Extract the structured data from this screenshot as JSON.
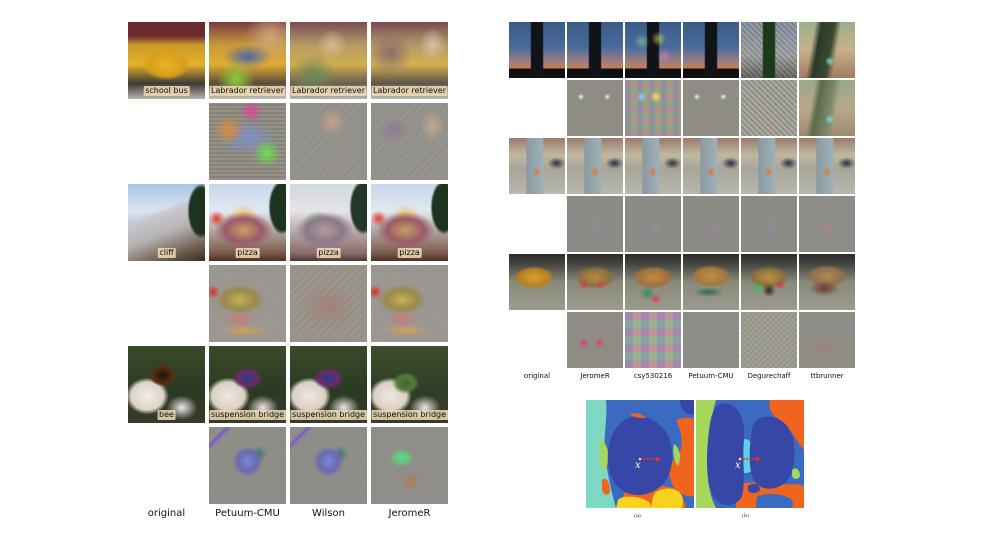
{
  "left_figure": {
    "column_labels": [
      "original",
      "Petuum-CMU",
      "Wilson",
      "JeromeR"
    ],
    "rows": [
      {
        "kind": "image",
        "labels": [
          "school bus",
          "Labrador retriever",
          "Labrador retriever",
          "Labrador retriever"
        ]
      },
      {
        "kind": "perturbation",
        "labels": [
          "",
          "",
          "",
          ""
        ]
      },
      {
        "kind": "image",
        "labels": [
          "cliff",
          "pizza",
          "pizza",
          "pizza"
        ]
      },
      {
        "kind": "perturbation",
        "labels": [
          "",
          "",
          "",
          ""
        ]
      },
      {
        "kind": "image",
        "labels": [
          "bee",
          "suspension bridge",
          "suspension bridge",
          "suspension bridge"
        ]
      },
      {
        "kind": "perturbation",
        "labels": [
          "",
          "",
          "",
          ""
        ]
      }
    ]
  },
  "right_figure": {
    "column_labels": [
      "original",
      "JeromeR",
      "csy530216",
      "Petuum-CMU",
      "Degurechaff",
      "ttbrunner"
    ],
    "rows": [
      {
        "kind": "image",
        "subject": "lighthouse"
      },
      {
        "kind": "perturbation",
        "subject": "lighthouse"
      },
      {
        "kind": "image",
        "subject": "kiosk"
      },
      {
        "kind": "perturbation",
        "subject": "kiosk"
      },
      {
        "kind": "image",
        "subject": "school bus"
      },
      {
        "kind": "perturbation",
        "subject": "school bus"
      }
    ]
  },
  "region_diagrams": {
    "panels": [
      {
        "sublabel": "(a)",
        "point_label": "x"
      },
      {
        "sublabel": "(b)",
        "point_label": "x"
      }
    ],
    "colors": {
      "dark_blue": "#3747a8",
      "mid_blue": "#3a6bc0",
      "teal": "#7fd8c4",
      "light_green": "#a6d65a",
      "orange": "#f0641e",
      "yellow": "#f7d21e",
      "cyan": "#5fd0e6",
      "arrow": "#e8302a",
      "point": "#f5e04a"
    }
  }
}
